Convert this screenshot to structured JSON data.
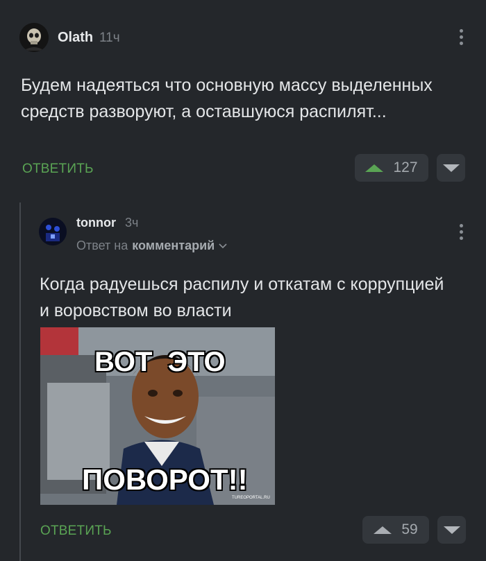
{
  "comment1": {
    "username": "Olath",
    "time": "11ч",
    "text": "Будем надеяться что основную массу выделенных средств разворуют, а оставшуюся распилят...",
    "reply_label": "ОТВЕТИТЬ",
    "votes": "127"
  },
  "comment2": {
    "username": "tonnor",
    "time": "3ч",
    "reply_to_prefix": "Ответ на",
    "reply_to_target": "комментарий",
    "text": "Когда радуешься распилу и откатам с коррупцией и воровством во власти",
    "image": {
      "caption_top": "ВОТ  ЭТО",
      "caption_bottom": "ПОВОРОТ!!",
      "watermark": "TUREOPORTAL.RU"
    },
    "reply_label": "ОТВЕТИТЬ",
    "votes": "59"
  },
  "colors": {
    "background": "#24272b",
    "accent_green": "#5aa454",
    "vote_box": "#33373c"
  },
  "icons": [
    "skull-avatar",
    "dark-avatar",
    "more-vertical-icon",
    "chevron-down-icon",
    "upvote-icon",
    "downvote-icon"
  ]
}
